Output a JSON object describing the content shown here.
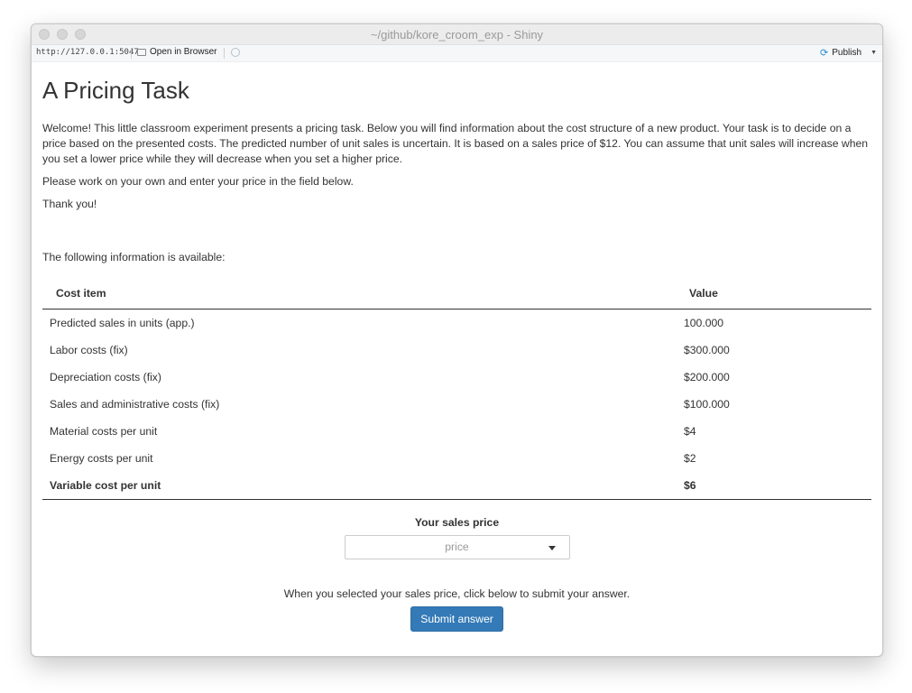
{
  "window": {
    "title": "~/github/kore_croom_exp - Shiny"
  },
  "toolbar": {
    "url": "http://127.0.0.1:5047",
    "open_label": "Open in Browser",
    "publish_label": "Publish"
  },
  "page": {
    "title": "A Pricing Task",
    "intro": "Welcome! This little classroom experiment presents a pricing task. Below you will find information about the cost structure of a new product. Your task is to decide on a price based on the presented costs. The predicted number of unit sales is uncertain. It is based on a sales price of $12. You can assume that unit sales will increase when you set a lower price while they will decrease when you set a higher price.",
    "work_alone": "Please work on your own and enter your price in the field below.",
    "thanks": "Thank you!",
    "info_heading": "The following information is available:"
  },
  "table": {
    "headers": [
      "Cost item",
      "Value"
    ],
    "rows": [
      {
        "item": "Predicted sales in units (app.)",
        "value": "100.000"
      },
      {
        "item": "Labor costs (fix)",
        "value": "$300.000"
      },
      {
        "item": "Depreciation costs (fix)",
        "value": "$200.000"
      },
      {
        "item": "Sales and administrative costs (fix)",
        "value": "$100.000"
      },
      {
        "item": "Material costs per unit",
        "value": "$4"
      },
      {
        "item": "Energy costs per unit",
        "value": "$2"
      },
      {
        "item": "Variable cost per unit",
        "value": "$6"
      }
    ]
  },
  "form": {
    "price_label": "Your sales price",
    "price_placeholder": "price",
    "instructions": "When you selected your sales price, click below to submit your answer.",
    "submit_label": "Submit answer"
  },
  "colors": {
    "button": "#337ab7",
    "publish_icon": "#2b8ed4"
  }
}
